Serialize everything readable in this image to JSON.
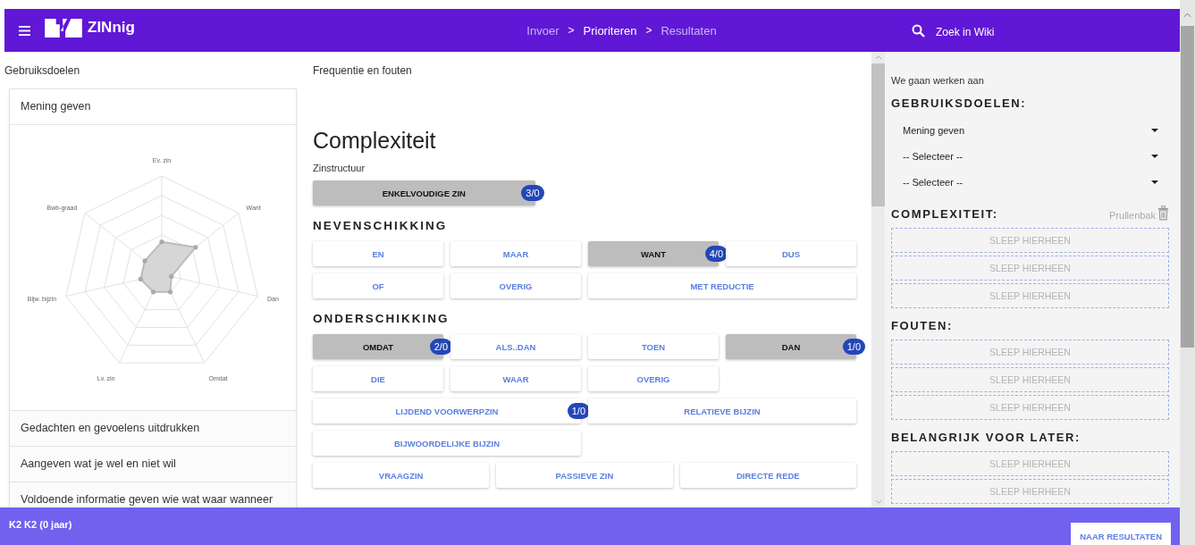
{
  "header": {
    "app_name": "ZINnig",
    "breadcrumb": {
      "items": [
        {
          "label": "Invoer",
          "selected": false
        },
        {
          "label": "Prioriteren",
          "selected": true
        },
        {
          "label": "Resultaten",
          "selected": false
        }
      ],
      "separators": [
        ">",
        ">"
      ]
    },
    "search_label": "Zoek in Wiki"
  },
  "goals": {
    "label": "Gebruiksdoelen",
    "items": [
      "Mening geven",
      "Gedachten en gevoelens uitdrukken",
      "Aangeven wat je wel en niet wil",
      "Voldoende informatie geven wie wat waar wanneer"
    ],
    "radar_labels": [
      "Ev. zin",
      "Want",
      "Dan",
      "Omdat",
      "Lv. zin",
      "Bijw. bijzin",
      "Bwb-graad"
    ]
  },
  "main": {
    "label": "Frequentie en fouten",
    "title": "Complexiteit",
    "groups": [
      {
        "kind": "label",
        "heading": "Zinstructuur",
        "rows": [
          [
            {
              "label": "ENKELVOUDIGE ZIN",
              "selected": true,
              "count": "3/0"
            }
          ]
        ]
      },
      {
        "kind": "section",
        "heading": "NEVENSCHIKKING",
        "rows": [
          [
            {
              "label": "EN",
              "selected": false
            },
            {
              "label": "MAAR",
              "selected": false
            },
            {
              "label": "WANT",
              "selected": true,
              "count": "4/0"
            },
            {
              "label": "DUS",
              "selected": false
            }
          ],
          [
            {
              "label": "OF",
              "selected": false
            },
            {
              "label": "OVERIG",
              "selected": false
            },
            {
              "label": "MET REDUCTIE",
              "selected": false
            }
          ]
        ]
      },
      {
        "kind": "section",
        "heading": "ONDERSCHIKKING",
        "rows": [
          [
            {
              "label": "OMDAT",
              "selected": true,
              "count": "2/0"
            },
            {
              "label": "ALS..DAN",
              "selected": false
            },
            {
              "label": "TOEN",
              "selected": false
            },
            {
              "label": "DAN",
              "selected": true,
              "count": "1/0"
            }
          ],
          [
            {
              "label": "DIE",
              "selected": false
            },
            {
              "label": "WAAR",
              "selected": false
            },
            {
              "label": "OVERIG",
              "selected": false
            }
          ],
          [
            {
              "label": "LIJDEND VOORWERPZIN",
              "selected": false,
              "count": "1/0"
            },
            {
              "label": "RELATIEVE BIJZIN",
              "selected": false
            }
          ],
          [
            {
              "label": "BIJWOORDELIJKE BIJZIN",
              "selected": false
            }
          ],
          [
            {
              "label": "VRAAGZIN",
              "selected": false
            },
            {
              "label": "PASSIEVE ZIN",
              "selected": false
            },
            {
              "label": "DIRECTE REDE",
              "selected": false
            }
          ]
        ]
      }
    ]
  },
  "plan": {
    "intro": "We gaan werken aan",
    "sections": [
      {
        "title": "GEBRUIKSDOELEN:",
        "dropdowns": [
          {
            "value": "Mening geven"
          },
          {
            "value": "-- Selecteer --"
          },
          {
            "value": "-- Selecteer --"
          }
        ]
      },
      {
        "title": "COMPLEXITEIT:",
        "trash_label": "Prullenbak",
        "drop_zones": [
          "SLEEP HIERHEEN",
          "SLEEP HIERHEEN",
          "SLEEP HIERHEEN"
        ]
      },
      {
        "title": "FOUTEN:",
        "drop_zones": [
          "SLEEP HIERHEEN",
          "SLEEP HIERHEEN",
          "SLEEP HIERHEEN"
        ]
      },
      {
        "title": "BELANGRIJK VOOR LATER:",
        "drop_zones": [
          "SLEEP HIERHEEN",
          "SLEEP HIERHEEN"
        ]
      }
    ]
  },
  "footer": {
    "student": "K2 K2 (0 jaar)",
    "button": "NAAR RESULTATEN"
  }
}
